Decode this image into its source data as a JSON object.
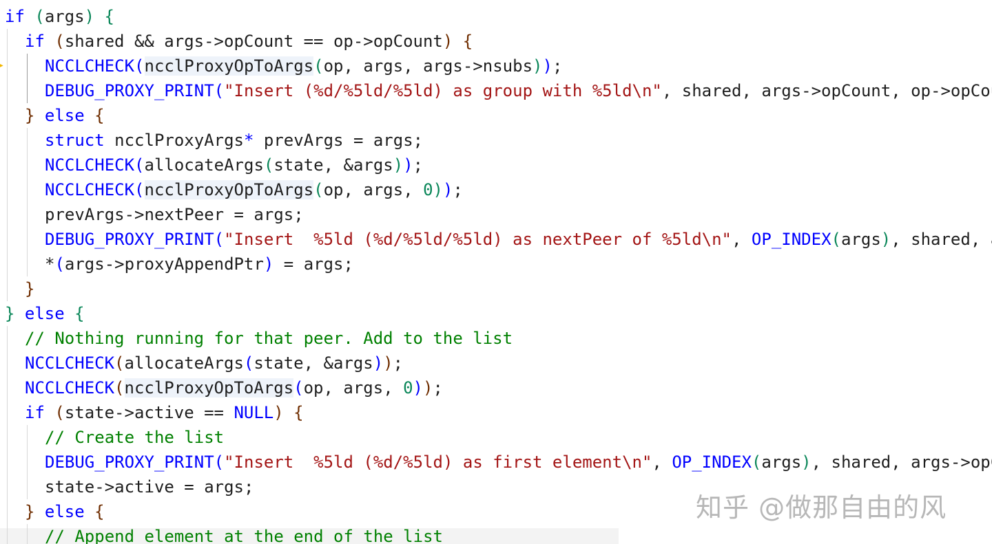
{
  "editor": {
    "watermark": "知乎 @做那自由的风"
  },
  "lines": [
    {
      "tokens": [
        {
          "t": "if",
          "c": "kw"
        },
        {
          "t": " "
        },
        {
          "t": "(",
          "c": "p1"
        },
        {
          "t": "args"
        },
        {
          "t": ")",
          "c": "p1"
        },
        {
          "t": " "
        },
        {
          "t": "{",
          "c": "p1"
        }
      ]
    },
    {
      "tokens": [
        {
          "t": "if",
          "c": "kw"
        },
        {
          "t": " "
        },
        {
          "t": "(",
          "c": "p2"
        },
        {
          "t": "shared && args->opCount == op->opCount"
        },
        {
          "t": ")",
          "c": "p2"
        },
        {
          "t": " "
        },
        {
          "t": "{",
          "c": "p2"
        }
      ]
    },
    {
      "tokens": [
        {
          "t": "NCCLCHECK",
          "c": "mac"
        },
        {
          "t": "(",
          "c": "p3"
        },
        {
          "t": "ncclProxyOpToArgs",
          "c": "hl"
        },
        {
          "t": "(",
          "c": "p1"
        },
        {
          "t": "op, args, args->nsubs"
        },
        {
          "t": ")",
          "c": "p1"
        },
        {
          "t": ")",
          "c": "p3"
        },
        {
          "t": ";"
        }
      ]
    },
    {
      "tokens": [
        {
          "t": "DEBUG_PROXY_PRINT",
          "c": "mac"
        },
        {
          "t": "(",
          "c": "p3"
        },
        {
          "t": "\"Insert (%d/%5ld/%5ld) as group with %5ld\\n\"",
          "c": "str"
        },
        {
          "t": ", shared, args->opCount, op->opCount, OP_INDEX(args));"
        }
      ]
    },
    {
      "tokens": [
        {
          "t": "}",
          "c": "p2"
        },
        {
          "t": " "
        },
        {
          "t": "else",
          "c": "kw"
        },
        {
          "t": " "
        },
        {
          "t": "{",
          "c": "p2"
        }
      ]
    },
    {
      "tokens": [
        {
          "t": "struct",
          "c": "kw"
        },
        {
          "t": " ncclProxyArgs"
        },
        {
          "t": "*",
          "c": "p3"
        },
        {
          "t": " prevArgs = args;"
        }
      ]
    },
    {
      "tokens": [
        {
          "t": "NCCLCHECK",
          "c": "mac"
        },
        {
          "t": "(",
          "c": "p3"
        },
        {
          "t": "allocateArgs"
        },
        {
          "t": "(",
          "c": "p1"
        },
        {
          "t": "state, &args"
        },
        {
          "t": ")",
          "c": "p1"
        },
        {
          "t": ")",
          "c": "p3"
        },
        {
          "t": ";"
        }
      ]
    },
    {
      "tokens": [
        {
          "t": "NCCLCHECK",
          "c": "mac"
        },
        {
          "t": "(",
          "c": "p3"
        },
        {
          "t": "ncclProxyOpToArgs",
          "c": "hl"
        },
        {
          "t": "(",
          "c": "p1"
        },
        {
          "t": "op, args, "
        },
        {
          "t": "0",
          "c": "num"
        },
        {
          "t": ")",
          "c": "p1"
        },
        {
          "t": ")",
          "c": "p3"
        },
        {
          "t": ";"
        }
      ]
    },
    {
      "tokens": [
        {
          "t": "prevArgs->nextPeer = args;"
        }
      ]
    },
    {
      "tokens": [
        {
          "t": "DEBUG_PROXY_PRINT",
          "c": "mac"
        },
        {
          "t": "(",
          "c": "p3"
        },
        {
          "t": "\"Insert  %5ld (%d/%5ld/%5ld) as nextPeer of %5ld\\n\"",
          "c": "str"
        },
        {
          "t": ", "
        },
        {
          "t": "OP_INDEX",
          "c": "mac"
        },
        {
          "t": "(",
          "c": "p1"
        },
        {
          "t": "args"
        },
        {
          "t": ")",
          "c": "p1"
        },
        {
          "t": ", shared, args->opCount, op->opCount, OP_INDEX(prevArgs));"
        }
      ]
    },
    {
      "tokens": [
        {
          "t": "*"
        },
        {
          "t": "(",
          "c": "p3"
        },
        {
          "t": "args->proxyAppendPtr"
        },
        {
          "t": ")",
          "c": "p3"
        },
        {
          "t": " = args;"
        }
      ]
    },
    {
      "tokens": [
        {
          "t": "}",
          "c": "p2"
        }
      ]
    },
    {
      "tokens": [
        {
          "t": "}",
          "c": "p1"
        },
        {
          "t": " "
        },
        {
          "t": "else",
          "c": "kw"
        },
        {
          "t": " "
        },
        {
          "t": "{",
          "c": "p1"
        }
      ]
    },
    {
      "tokens": [
        {
          "t": "// Nothing running for that peer. Add to the list",
          "c": "com"
        }
      ]
    },
    {
      "tokens": [
        {
          "t": "NCCLCHECK",
          "c": "mac"
        },
        {
          "t": "(",
          "c": "p2"
        },
        {
          "t": "allocateArgs"
        },
        {
          "t": "(",
          "c": "p3"
        },
        {
          "t": "state, &args"
        },
        {
          "t": ")",
          "c": "p3"
        },
        {
          "t": ")",
          "c": "p2"
        },
        {
          "t": ";"
        }
      ]
    },
    {
      "tokens": [
        {
          "t": "NCCLCHECK",
          "c": "mac"
        },
        {
          "t": "(",
          "c": "p2"
        },
        {
          "t": "ncclProxyOpToArgs",
          "c": "hl"
        },
        {
          "t": "(",
          "c": "p3"
        },
        {
          "t": "op, args, "
        },
        {
          "t": "0",
          "c": "num"
        },
        {
          "t": ")",
          "c": "p3"
        },
        {
          "t": ")",
          "c": "p2"
        },
        {
          "t": ";"
        }
      ]
    },
    {
      "tokens": [
        {
          "t": "if",
          "c": "kw"
        },
        {
          "t": " "
        },
        {
          "t": "(",
          "c": "p2"
        },
        {
          "t": "state->active == "
        },
        {
          "t": "NULL",
          "c": "kw"
        },
        {
          "t": ")",
          "c": "p2"
        },
        {
          "t": " "
        },
        {
          "t": "{",
          "c": "p2"
        }
      ]
    },
    {
      "tokens": [
        {
          "t": "// Create the list",
          "c": "com"
        }
      ]
    },
    {
      "tokens": [
        {
          "t": "DEBUG_PROXY_PRINT",
          "c": "mac"
        },
        {
          "t": "(",
          "c": "p3"
        },
        {
          "t": "\"Insert  %5ld (%d/%5ld) as first element\\n\"",
          "c": "str"
        },
        {
          "t": ", "
        },
        {
          "t": "OP_INDEX",
          "c": "mac"
        },
        {
          "t": "(",
          "c": "p1"
        },
        {
          "t": "args"
        },
        {
          "t": ")",
          "c": "p1"
        },
        {
          "t": ", shared, args->opCount);"
        }
      ]
    },
    {
      "tokens": [
        {
          "t": "state->active = args;"
        }
      ]
    },
    {
      "tokens": [
        {
          "t": "}",
          "c": "p2"
        },
        {
          "t": " "
        },
        {
          "t": "else",
          "c": "kw"
        },
        {
          "t": " "
        },
        {
          "t": "{",
          "c": "p2"
        }
      ]
    },
    {
      "tokens": [
        {
          "t": "// Append element at the end of the list",
          "c": "com"
        }
      ]
    }
  ]
}
